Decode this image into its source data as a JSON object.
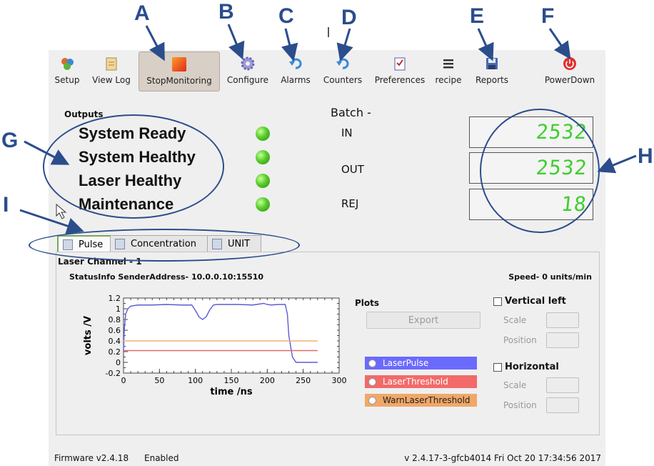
{
  "callouts": {
    "a": "A",
    "b": "B",
    "c": "C",
    "d": "D",
    "e": "E",
    "f": "F",
    "g": "G",
    "h": "H",
    "i": "I"
  },
  "toolbar": {
    "setup": "Setup",
    "view_log": "View Log",
    "stop_monitoring": "StopMonitoring",
    "configure": "Configure",
    "alarms": "Alarms",
    "counters": "Counters",
    "preferences": "Preferences",
    "recipe": "recipe",
    "reports": "Reports",
    "power_down": "PowerDown"
  },
  "outputs": {
    "title": "Outputs",
    "items": [
      "System Ready",
      "System Healthy",
      "Laser Healthy",
      "Maintenance"
    ],
    "led_color": "#4cc02a"
  },
  "batch": {
    "title": "Batch -",
    "rows": [
      {
        "label": "IN",
        "value": "2532"
      },
      {
        "label": "OUT",
        "value": "2532"
      },
      {
        "label": "REJ",
        "value": "18"
      }
    ],
    "digit_color": "#3fcf2f"
  },
  "tabs": [
    "Pulse",
    "Concentration",
    "UNIT"
  ],
  "panel": {
    "laser_channel": "Laser Channel - 1",
    "status_info": "StatusInfo SenderAddress- 10.0.0.10:15510",
    "speed": "Speed- 0 units/min",
    "plots_title": "Plots",
    "export_label": "Export",
    "vertical_left": "Vertical left",
    "horizontal": "Horizontal",
    "scale_label": "Scale",
    "position_label": "Position",
    "legend": [
      {
        "label": "LaserPulse",
        "color": "#6a6aff"
      },
      {
        "label": "LaserThreshold",
        "color": "#f26a6a"
      },
      {
        "label": "WarnLaserThreshold",
        "color": "#f0a868"
      }
    ]
  },
  "chart_data": {
    "type": "line",
    "xlabel": "time /ns",
    "ylabel": "volts /V",
    "xlim": [
      0,
      300
    ],
    "ylim": [
      -0.2,
      1.2
    ],
    "xticks": [
      "0",
      "50",
      "100",
      "150",
      "200",
      "250",
      "300"
    ],
    "yticks": [
      "1.2",
      "1",
      "0.8",
      "0.6",
      "0.4",
      "0.2",
      "0",
      "-0.2"
    ],
    "series": [
      {
        "name": "LaserPulse",
        "color": "#5b5bd6",
        "x": [
          0,
          1,
          3,
          6,
          10,
          20,
          40,
          60,
          80,
          95,
          100,
          105,
          110,
          115,
          120,
          125,
          130,
          140,
          160,
          180,
          195,
          200,
          205,
          215,
          225,
          228,
          230,
          235,
          240,
          250,
          270
        ],
        "y": [
          0.2,
          0.6,
          0.9,
          1.0,
          1.05,
          1.07,
          1.07,
          1.08,
          1.07,
          1.07,
          0.97,
          0.85,
          0.8,
          0.85,
          0.98,
          1.07,
          1.08,
          1.08,
          1.08,
          1.07,
          1.1,
          1.08,
          1.07,
          1.08,
          1.08,
          0.9,
          0.5,
          0.1,
          0.0,
          0.0,
          0.0
        ]
      },
      {
        "name": "LaserThreshold",
        "color": "#e06a6a",
        "x": [
          0,
          270
        ],
        "y": [
          0.22,
          0.22
        ]
      },
      {
        "name": "WarnLaserThreshold",
        "color": "#f0b070",
        "x": [
          0,
          270
        ],
        "y": [
          0.4,
          0.4
        ]
      }
    ]
  },
  "statusbar": {
    "firmware": "Firmware v2.4.18",
    "enabled": "Enabled",
    "version": "v 2.4.17-3-gfcb4014  Fri Oct 20 17:34:56 2017"
  }
}
